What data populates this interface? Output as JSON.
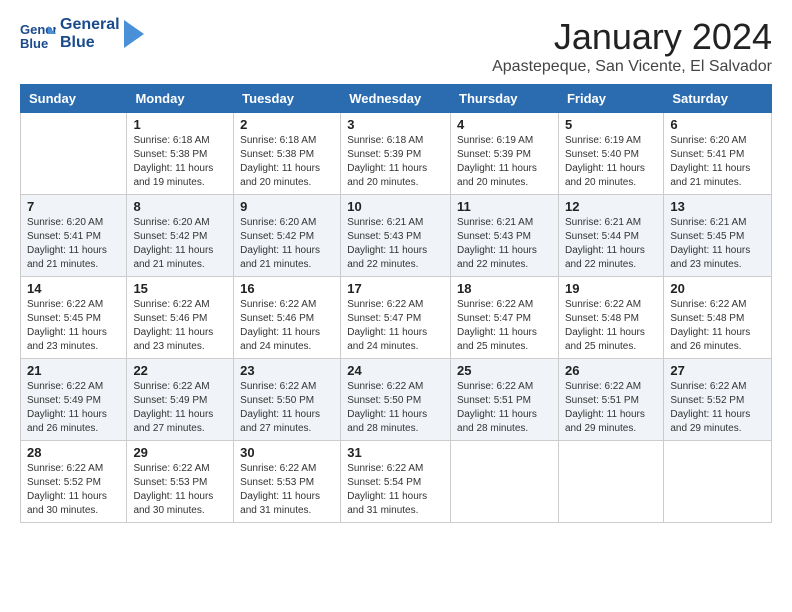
{
  "header": {
    "logo_line1": "General",
    "logo_line2": "Blue",
    "month": "January 2024",
    "location": "Apastepeque, San Vicente, El Salvador"
  },
  "weekdays": [
    "Sunday",
    "Monday",
    "Tuesday",
    "Wednesday",
    "Thursday",
    "Friday",
    "Saturday"
  ],
  "weeks": [
    [
      {
        "day": "",
        "detail": ""
      },
      {
        "day": "1",
        "detail": "Sunrise: 6:18 AM\nSunset: 5:38 PM\nDaylight: 11 hours\nand 19 minutes."
      },
      {
        "day": "2",
        "detail": "Sunrise: 6:18 AM\nSunset: 5:38 PM\nDaylight: 11 hours\nand 20 minutes."
      },
      {
        "day": "3",
        "detail": "Sunrise: 6:18 AM\nSunset: 5:39 PM\nDaylight: 11 hours\nand 20 minutes."
      },
      {
        "day": "4",
        "detail": "Sunrise: 6:19 AM\nSunset: 5:39 PM\nDaylight: 11 hours\nand 20 minutes."
      },
      {
        "day": "5",
        "detail": "Sunrise: 6:19 AM\nSunset: 5:40 PM\nDaylight: 11 hours\nand 20 minutes."
      },
      {
        "day": "6",
        "detail": "Sunrise: 6:20 AM\nSunset: 5:41 PM\nDaylight: 11 hours\nand 21 minutes."
      }
    ],
    [
      {
        "day": "7",
        "detail": "Sunrise: 6:20 AM\nSunset: 5:41 PM\nDaylight: 11 hours\nand 21 minutes."
      },
      {
        "day": "8",
        "detail": "Sunrise: 6:20 AM\nSunset: 5:42 PM\nDaylight: 11 hours\nand 21 minutes."
      },
      {
        "day": "9",
        "detail": "Sunrise: 6:20 AM\nSunset: 5:42 PM\nDaylight: 11 hours\nand 21 minutes."
      },
      {
        "day": "10",
        "detail": "Sunrise: 6:21 AM\nSunset: 5:43 PM\nDaylight: 11 hours\nand 22 minutes."
      },
      {
        "day": "11",
        "detail": "Sunrise: 6:21 AM\nSunset: 5:43 PM\nDaylight: 11 hours\nand 22 minutes."
      },
      {
        "day": "12",
        "detail": "Sunrise: 6:21 AM\nSunset: 5:44 PM\nDaylight: 11 hours\nand 22 minutes."
      },
      {
        "day": "13",
        "detail": "Sunrise: 6:21 AM\nSunset: 5:45 PM\nDaylight: 11 hours\nand 23 minutes."
      }
    ],
    [
      {
        "day": "14",
        "detail": "Sunrise: 6:22 AM\nSunset: 5:45 PM\nDaylight: 11 hours\nand 23 minutes."
      },
      {
        "day": "15",
        "detail": "Sunrise: 6:22 AM\nSunset: 5:46 PM\nDaylight: 11 hours\nand 23 minutes."
      },
      {
        "day": "16",
        "detail": "Sunrise: 6:22 AM\nSunset: 5:46 PM\nDaylight: 11 hours\nand 24 minutes."
      },
      {
        "day": "17",
        "detail": "Sunrise: 6:22 AM\nSunset: 5:47 PM\nDaylight: 11 hours\nand 24 minutes."
      },
      {
        "day": "18",
        "detail": "Sunrise: 6:22 AM\nSunset: 5:47 PM\nDaylight: 11 hours\nand 25 minutes."
      },
      {
        "day": "19",
        "detail": "Sunrise: 6:22 AM\nSunset: 5:48 PM\nDaylight: 11 hours\nand 25 minutes."
      },
      {
        "day": "20",
        "detail": "Sunrise: 6:22 AM\nSunset: 5:48 PM\nDaylight: 11 hours\nand 26 minutes."
      }
    ],
    [
      {
        "day": "21",
        "detail": "Sunrise: 6:22 AM\nSunset: 5:49 PM\nDaylight: 11 hours\nand 26 minutes."
      },
      {
        "day": "22",
        "detail": "Sunrise: 6:22 AM\nSunset: 5:49 PM\nDaylight: 11 hours\nand 27 minutes."
      },
      {
        "day": "23",
        "detail": "Sunrise: 6:22 AM\nSunset: 5:50 PM\nDaylight: 11 hours\nand 27 minutes."
      },
      {
        "day": "24",
        "detail": "Sunrise: 6:22 AM\nSunset: 5:50 PM\nDaylight: 11 hours\nand 28 minutes."
      },
      {
        "day": "25",
        "detail": "Sunrise: 6:22 AM\nSunset: 5:51 PM\nDaylight: 11 hours\nand 28 minutes."
      },
      {
        "day": "26",
        "detail": "Sunrise: 6:22 AM\nSunset: 5:51 PM\nDaylight: 11 hours\nand 29 minutes."
      },
      {
        "day": "27",
        "detail": "Sunrise: 6:22 AM\nSunset: 5:52 PM\nDaylight: 11 hours\nand 29 minutes."
      }
    ],
    [
      {
        "day": "28",
        "detail": "Sunrise: 6:22 AM\nSunset: 5:52 PM\nDaylight: 11 hours\nand 30 minutes."
      },
      {
        "day": "29",
        "detail": "Sunrise: 6:22 AM\nSunset: 5:53 PM\nDaylight: 11 hours\nand 30 minutes."
      },
      {
        "day": "30",
        "detail": "Sunrise: 6:22 AM\nSunset: 5:53 PM\nDaylight: 11 hours\nand 31 minutes."
      },
      {
        "day": "31",
        "detail": "Sunrise: 6:22 AM\nSunset: 5:54 PM\nDaylight: 11 hours\nand 31 minutes."
      },
      {
        "day": "",
        "detail": ""
      },
      {
        "day": "",
        "detail": ""
      },
      {
        "day": "",
        "detail": ""
      }
    ]
  ]
}
